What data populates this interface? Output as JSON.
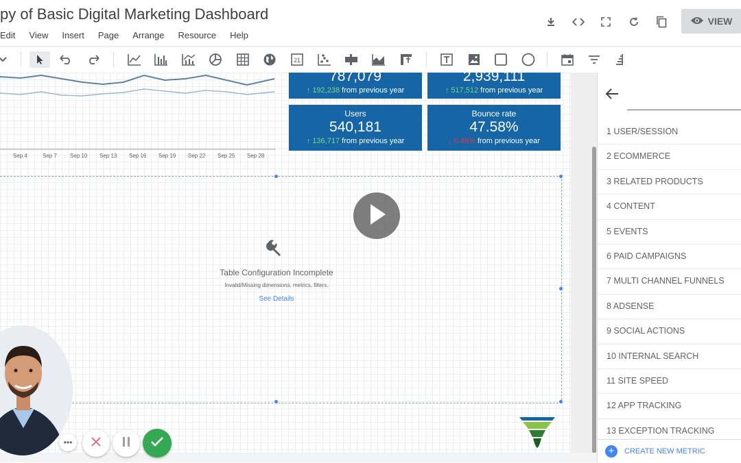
{
  "header": {
    "title": "py of Basic Digital Marketing Dashboard",
    "menu": [
      "Edit",
      "View",
      "Insert",
      "Page",
      "Arrange",
      "Resource",
      "Help"
    ],
    "view_label": "VIEW"
  },
  "chart": {
    "x_ticks": [
      "Sep 4",
      "Sep 7",
      "Sep 10",
      "Sep 13",
      "Sep 16",
      "Sep 19",
      "Sep 22",
      "Sep 25",
      "Sep 28"
    ]
  },
  "scorecards": [
    {
      "label": "",
      "value": "787,079",
      "delta": "192,238",
      "direction": "up",
      "suffix": "from previous year"
    },
    {
      "label": "",
      "value": "2,939,111",
      "delta": "517,512",
      "direction": "up",
      "suffix": "from previous year"
    },
    {
      "label": "Users",
      "value": "540,181",
      "delta": "136,717",
      "direction": "up",
      "suffix": "from previous year"
    },
    {
      "label": "Bounce rate",
      "value": "47.58%",
      "delta": "0.46%",
      "direction": "down",
      "suffix": "from previous year"
    }
  ],
  "table_placeholder": {
    "title": "Table Configuration Incomplete",
    "subtitle": "Invalid/Missing dimensions, metrics, filters.",
    "link": "See Details"
  },
  "panel": {
    "search_placeholder": "",
    "items": [
      "1 USER/SESSION",
      "2 ECOMMERCE",
      "3 RELATED PRODUCTS",
      "4 CONTENT",
      "5 EVENTS",
      "6 PAID CAMPAIGNS",
      "7 MULTI CHANNEL FUNNELS",
      "8 ADSENSE",
      "9 SOCIAL ACTIONS",
      "10 INTERNAL SEARCH",
      "11 SITE SPEED",
      "12 APP TRACKING",
      "13 EXCEPTION TRACKING"
    ],
    "create_label": "CREATE NEW METRIC"
  },
  "colors": {
    "scorecard_bg": "#1565a7",
    "accent": "#4285f4",
    "confirm": "#34a853",
    "cancel": "#e57373"
  }
}
